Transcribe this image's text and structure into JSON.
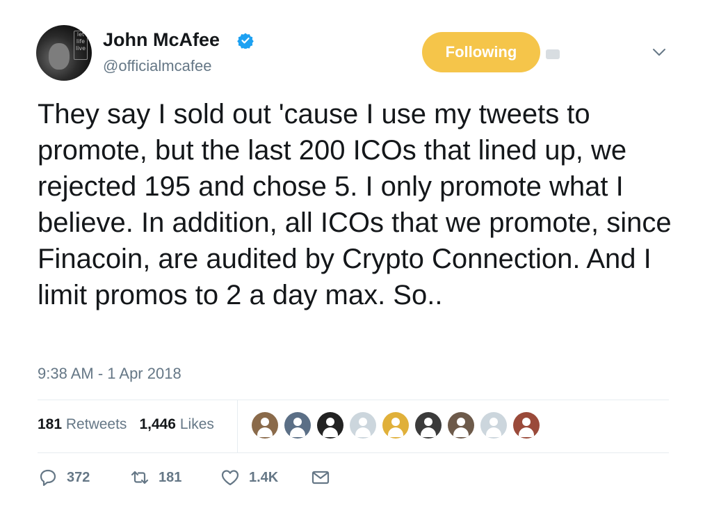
{
  "author": {
    "name": "John McAfee",
    "handle": "@officialmcafee",
    "avatar_sign_text": [
      "let",
      "life",
      "live"
    ]
  },
  "follow_button": {
    "label": "Following",
    "color": "#f5c54a"
  },
  "tweet": {
    "text": "They say I sold out 'cause I use my tweets to promote, but the last 200 ICOs that lined up, we rejected 195 and chose 5. I only promote what I believe. In addition, all ICOs that we promote, since Finacoin, are audited by Crypto Connection. And I limit promos to 2 a day max. So..",
    "timestamp": "9:38 AM - 1 Apr 2018"
  },
  "stats": {
    "retweets_count": "181",
    "retweets_label": "Retweets",
    "likes_count": "1,446",
    "likes_label": "Likes"
  },
  "likers": [
    {
      "icon": "user-avatar",
      "color": "#8a6a4a"
    },
    {
      "icon": "user-avatar",
      "color": "#5b6f86"
    },
    {
      "icon": "user-avatar",
      "color": "#222222"
    },
    {
      "icon": "default-avatar-icon",
      "color": "#ccd6dd"
    },
    {
      "icon": "user-avatar",
      "color": "#e0b03a"
    },
    {
      "icon": "user-avatar",
      "color": "#3b3b3b"
    },
    {
      "icon": "user-avatar",
      "color": "#6d5a4a"
    },
    {
      "icon": "default-avatar-icon",
      "color": "#ccd6dd"
    },
    {
      "icon": "user-avatar",
      "color": "#9a4a3a"
    }
  ],
  "actions": {
    "reply_count": "372",
    "retweet_count": "181",
    "like_count": "1.4K"
  },
  "colors": {
    "text_primary": "#14171a",
    "text_secondary": "#657786",
    "verified_blue": "#1da1f2",
    "divider": "#e6ecf0"
  }
}
